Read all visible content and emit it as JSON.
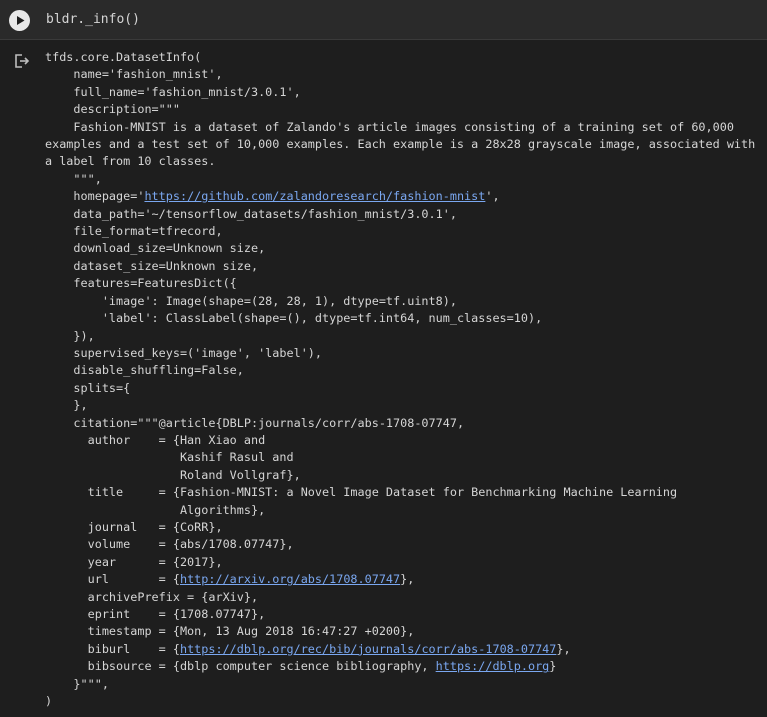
{
  "cell": {
    "code": "bldr._info()"
  },
  "output": {
    "lines": [
      {
        "segs": [
          {
            "t": "tfds.core.DatasetInfo("
          }
        ]
      },
      {
        "segs": [
          {
            "t": "    name='fashion_mnist',"
          }
        ]
      },
      {
        "segs": [
          {
            "t": "    full_name='fashion_mnist/3.0.1',"
          }
        ]
      },
      {
        "segs": [
          {
            "t": "    description=\"\"\""
          }
        ]
      },
      {
        "segs": [
          {
            "t": "    Fashion-MNIST is a dataset of Zalando's article images consisting of a training set of 60,000 examples and a test set of 10,000 examples. Each example is a 28x28 grayscale image, associated with a label from 10 classes."
          }
        ]
      },
      {
        "segs": [
          {
            "t": "    \"\"\","
          }
        ]
      },
      {
        "segs": [
          {
            "t": "    homepage='"
          },
          {
            "t": "https://github.com/zalandoresearch/fashion-mnist",
            "link": true,
            "name": "homepage-link"
          },
          {
            "t": "',"
          }
        ]
      },
      {
        "segs": [
          {
            "t": "    data_path='~/tensorflow_datasets/fashion_mnist/3.0.1',"
          }
        ]
      },
      {
        "segs": [
          {
            "t": "    file_format=tfrecord,"
          }
        ]
      },
      {
        "segs": [
          {
            "t": "    download_size=Unknown size,"
          }
        ]
      },
      {
        "segs": [
          {
            "t": "    dataset_size=Unknown size,"
          }
        ]
      },
      {
        "segs": [
          {
            "t": "    features=FeaturesDict({"
          }
        ]
      },
      {
        "segs": [
          {
            "t": "        'image': Image(shape=(28, 28, 1), dtype=tf.uint8),"
          }
        ]
      },
      {
        "segs": [
          {
            "t": "        'label': ClassLabel(shape=(), dtype=tf.int64, num_classes=10),"
          }
        ]
      },
      {
        "segs": [
          {
            "t": "    }),"
          }
        ]
      },
      {
        "segs": [
          {
            "t": "    supervised_keys=('image', 'label'),"
          }
        ]
      },
      {
        "segs": [
          {
            "t": "    disable_shuffling=False,"
          }
        ]
      },
      {
        "segs": [
          {
            "t": "    splits={"
          }
        ]
      },
      {
        "segs": [
          {
            "t": "    },"
          }
        ]
      },
      {
        "segs": [
          {
            "t": "    citation=\"\"\"@article{DBLP:journals/corr/abs-1708-07747,"
          }
        ]
      },
      {
        "segs": [
          {
            "t": "      author    = {Han Xiao and"
          }
        ]
      },
      {
        "segs": [
          {
            "t": "                   Kashif Rasul and"
          }
        ]
      },
      {
        "segs": [
          {
            "t": "                   Roland Vollgraf},"
          }
        ]
      },
      {
        "segs": [
          {
            "t": "      title     = {Fashion-MNIST: a Novel Image Dataset for Benchmarking Machine Learning"
          }
        ]
      },
      {
        "segs": [
          {
            "t": "                   Algorithms},"
          }
        ]
      },
      {
        "segs": [
          {
            "t": "      journal   = {CoRR},"
          }
        ]
      },
      {
        "segs": [
          {
            "t": "      volume    = {abs/1708.07747},"
          }
        ]
      },
      {
        "segs": [
          {
            "t": "      year      = {2017},"
          }
        ]
      },
      {
        "segs": [
          {
            "t": "      url       = {"
          },
          {
            "t": "http://arxiv.org/abs/1708.07747",
            "link": true,
            "name": "arxiv-link"
          },
          {
            "t": "},"
          }
        ]
      },
      {
        "segs": [
          {
            "t": "      archivePrefix = {arXiv},"
          }
        ]
      },
      {
        "segs": [
          {
            "t": "      eprint    = {1708.07747},"
          }
        ]
      },
      {
        "segs": [
          {
            "t": "      timestamp = {Mon, 13 Aug 2018 16:47:27 +0200},"
          }
        ]
      },
      {
        "segs": [
          {
            "t": "      biburl    = {"
          },
          {
            "t": "https://dblp.org/rec/bib/journals/corr/abs-1708-07747",
            "link": true,
            "name": "biburl-link"
          },
          {
            "t": "},"
          }
        ]
      },
      {
        "segs": [
          {
            "t": "      bibsource = {dblp computer science bibliography, "
          },
          {
            "t": "https://dblp.org",
            "link": true,
            "name": "dblp-link"
          },
          {
            "t": "}"
          }
        ]
      },
      {
        "segs": [
          {
            "t": "    }\"\"\","
          }
        ]
      },
      {
        "segs": [
          {
            "t": ")"
          }
        ]
      }
    ]
  },
  "icons": {
    "run": "play-icon",
    "output": "output-redirect-icon"
  },
  "colors": {
    "background": "#1e1e1e",
    "input_background": "#2a2a2a",
    "text": "#d5d5d5",
    "link": "#7aa7f0"
  }
}
